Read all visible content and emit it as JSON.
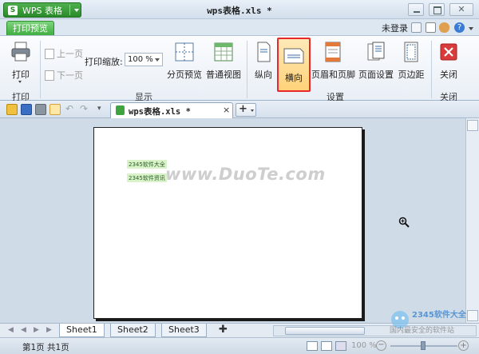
{
  "app": {
    "name": "WPS 表格",
    "logo_letter": "S",
    "document_title": "wps表格.xls *"
  },
  "tabs": {
    "print_preview": "打印预览",
    "login": "未登录"
  },
  "ribbon": {
    "print": {
      "label": "打印",
      "group": "打印"
    },
    "prev_page": "上一页",
    "next_page": "下一页",
    "zoom_label": "打印缩放:",
    "zoom_value": "100 %",
    "page_break_preview": "分页预览",
    "normal_view": "普通视图",
    "display_group": "显示",
    "portrait": "纵向",
    "landscape": "横向",
    "header_footer": "页眉和页脚",
    "page_setup": "页面设置",
    "margins": "页边距",
    "settings_group": "设置",
    "close": "关闭",
    "close_group": "关闭"
  },
  "doc_tab": {
    "name": "wps表格.xls *",
    "close": "×",
    "add": "+"
  },
  "preview": {
    "cells": [
      "2345软件大全",
      "2345软件资讯"
    ],
    "watermark": "www.DuoTe.com"
  },
  "sheets": [
    "Sheet1",
    "Sheet2",
    "Sheet3"
  ],
  "status": {
    "page_info": "第1页 共1页",
    "zoom": "100 %"
  },
  "watermark_corner": {
    "line1": "2345软件大全",
    "line2": "国内最安全的软件站"
  },
  "colors": {
    "accent_green": "#3fae3f",
    "selected_border": "#e8282a",
    "selected_fill": "#ffd27a",
    "close_red": "#d93a3a"
  }
}
